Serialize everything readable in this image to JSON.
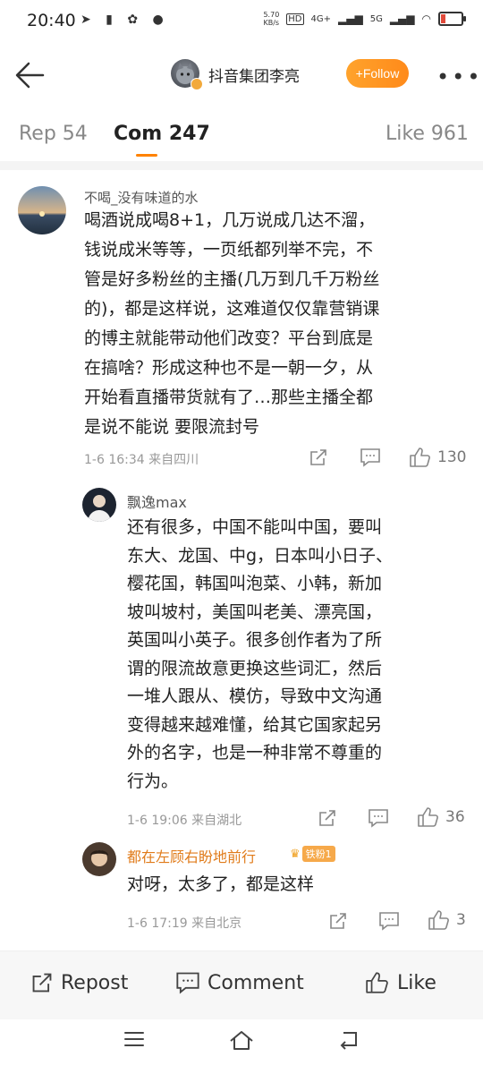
{
  "status_bar": {
    "time": "20:40",
    "speed": "5.70\nKB/s",
    "hd": "HD",
    "sig1": "4G+",
    "sig2": "5G"
  },
  "header": {
    "title": "抖音集团李亮",
    "follow_label": "+Follow"
  },
  "tabs": [
    {
      "label": "Rep 54"
    },
    {
      "label": "Com 247"
    },
    {
      "label": "Like 961"
    }
  ],
  "comments": [
    {
      "user": "不喝_没有味道的水",
      "lines": [
        "喝酒说成喝8+1，几万说成几达不溜，",
        "钱说成米等等，一页纸都列举不完，不",
        "管是好多粉丝的主播(几万到几千万粉丝",
        "的)，都是这样说，这难道仅仅靠营销课",
        "的博主就能带动他们改变？平台到底是",
        "在搞啥？形成这种也不是一朝一夕，从",
        "开始看直播带货就有了…那些主播全都",
        "是说不能说 要限流封号"
      ],
      "meta": "1-6 16:34  来自四川",
      "likes": "130"
    },
    {
      "user": "飘逸max",
      "lines": [
        "还有很多，中国不能叫中国，要叫",
        "东大、龙国、中g，日本叫小日子、",
        "樱花国，韩国叫泡菜、小韩，新加",
        "坡叫坡村，美国叫老美、漂亮国，",
        "英国叫小英子。很多创作者为了所",
        "谓的限流故意更换这些词汇，然后",
        "一堆人跟从、模仿，导致中文沟通",
        "变得越来越难懂，给其它国家起另",
        "外的名字，也是一种非常不尊重的",
        "行为。"
      ],
      "meta": "1-6 19:06  来自湖北",
      "likes": "36"
    },
    {
      "user": "都在左顾右盼地前行",
      "fan_badge": "铁粉1",
      "lines": [
        "对呀，太多了，都是这样"
      ],
      "meta": "1-6 17:19  来自北京",
      "likes": "3"
    }
  ],
  "bottom_bar": {
    "repost": "Repost",
    "comment": "Comment",
    "like": "Like"
  },
  "icons": [
    "back-arrow-icon",
    "share-icon",
    "comment-icon",
    "thumbs-up-icon",
    "menu-icon",
    "home-icon",
    "return-icon"
  ],
  "colors": {
    "accent": "#ff8200",
    "username_orange": "#e07b1a"
  }
}
